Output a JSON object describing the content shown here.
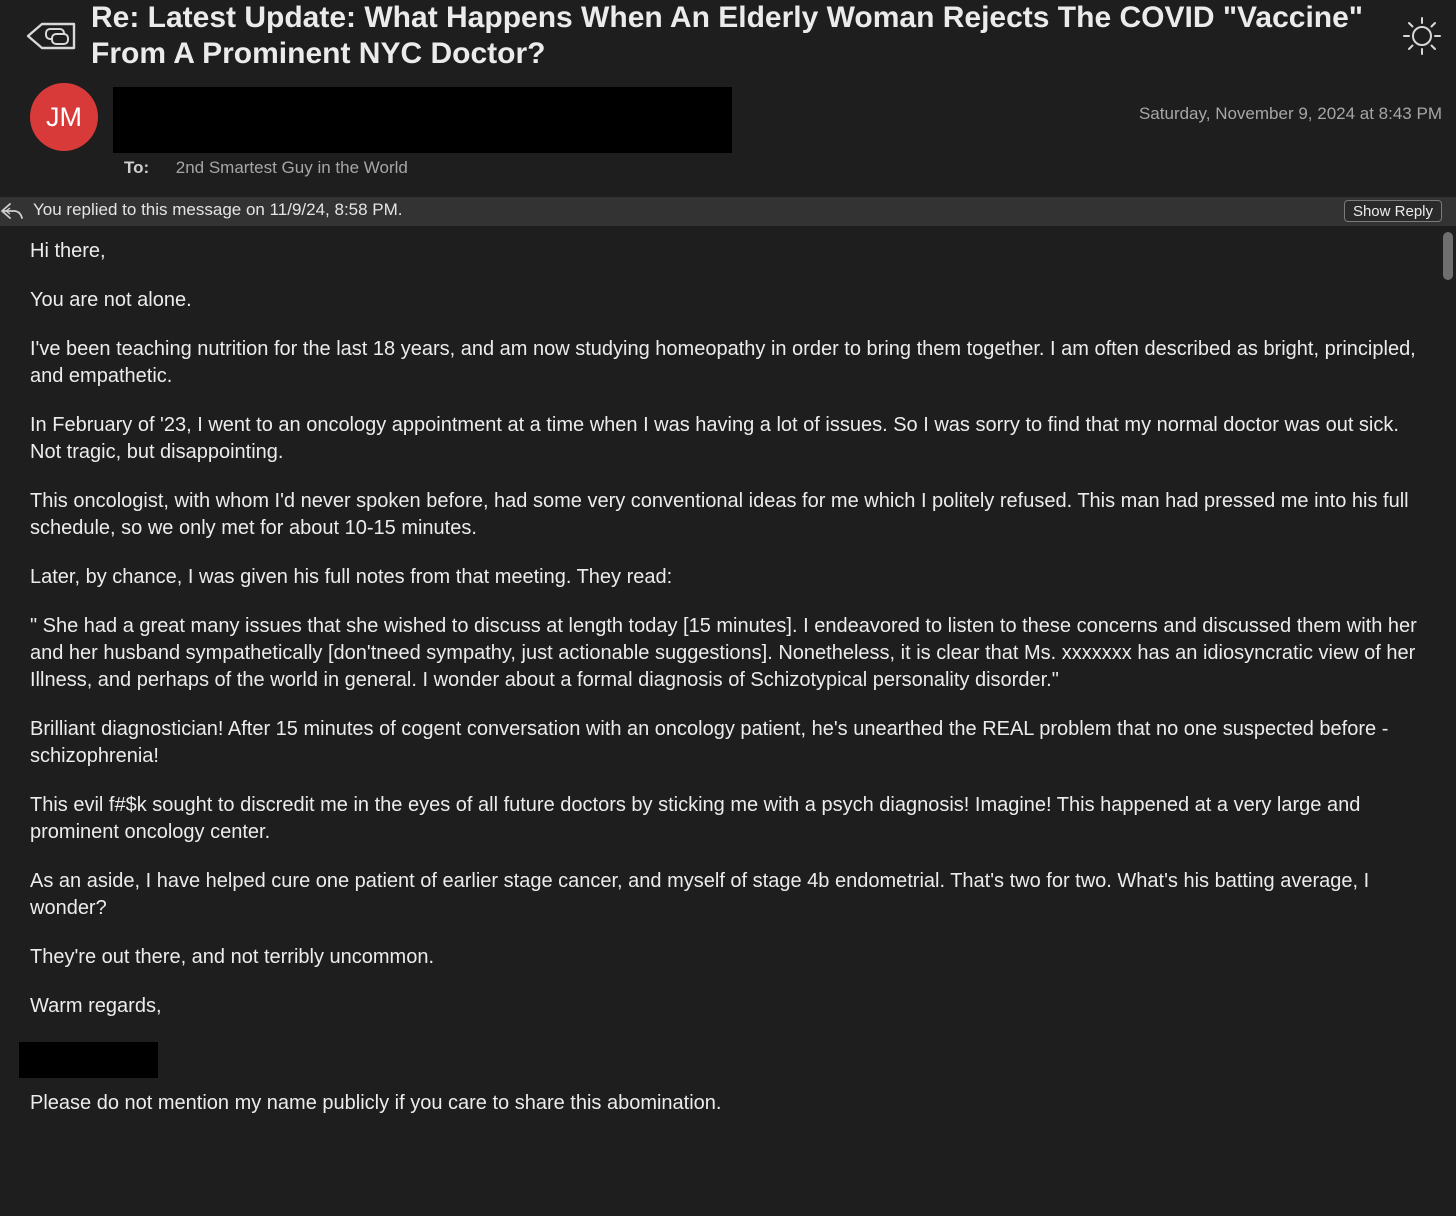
{
  "email": {
    "subject": "Re: Latest Update: What Happens When An Elderly Woman Rejects The COVID \"Vaccine\" From A Prominent NYC Doctor?",
    "sender_initials": "JM",
    "date": "Saturday, November 9, 2024 at 8:43 PM",
    "to_label": "To:",
    "to_value": "2nd Smartest Guy in the World"
  },
  "reply_bar": {
    "text": "You replied to this message on 11/9/24, 8:58 PM.",
    "show_reply_label": "Show Reply"
  },
  "body": {
    "greeting": "Hi there,",
    "p1": "You are not alone.",
    "p2": "I've been teaching nutrition for the last 18 years, and am now studying homeopathy in order to bring them together. I am often described as bright, principled, and empathetic.",
    "p3": "In February of '23, I went to an oncology appointment at a time when I was having a lot of issues. So I was sorry to find that my normal doctor was out sick. Not tragic, but disappointing.",
    "p4": "This oncologist, with whom I'd never spoken before, had some very conventional ideas for me which I politely refused. This man had pressed me into his full schedule, so we only met for about 10-15 minutes.",
    "p5": "Later, by chance, I was given his full notes from that meeting. They read:",
    "p6": "\" She had a great many issues that she wished to discuss at length today [15 minutes]. I endeavored to listen to these concerns and discussed them with her and her husband sympathetically [don'tneed sympathy, just actionable suggestions]. Nonetheless, it is clear that Ms. xxxxxxx has an idiosyncratic view of her Illness, and perhaps of the world in general. I wonder about a formal diagnosis of Schizotypical personality disorder.\"",
    "p7": "Brilliant diagnostician! After 15 minutes of cogent conversation with an oncology patient, he's unearthed the REAL problem that no one suspected before - schizophrenia!",
    "p8": "This evil f#$k sought to discredit me in the eyes of all future doctors by sticking me with a psych diagnosis! Imagine! This happened at a very large and prominent oncology center.",
    "p9": "As an aside, I have helped cure one patient of earlier stage cancer, and myself of stage 4b endometrial. That's two for two. What's his batting average, I wonder?",
    "p10": "They're out there, and not terribly uncommon.",
    "closing": "Warm regards,",
    "postscript": "Please do not mention my name publicly if you care to share this abomination."
  },
  "colors": {
    "background": "#1e1e1e",
    "reply_bar": "#333333",
    "avatar": "#d83a3a",
    "text": "#ececec",
    "secondary_text": "#a6a6a6",
    "redaction": "#000000"
  },
  "icons": {
    "thread": "conversation-thread-icon",
    "theme": "sun-icon",
    "reply": "reply-arrow-icon"
  }
}
